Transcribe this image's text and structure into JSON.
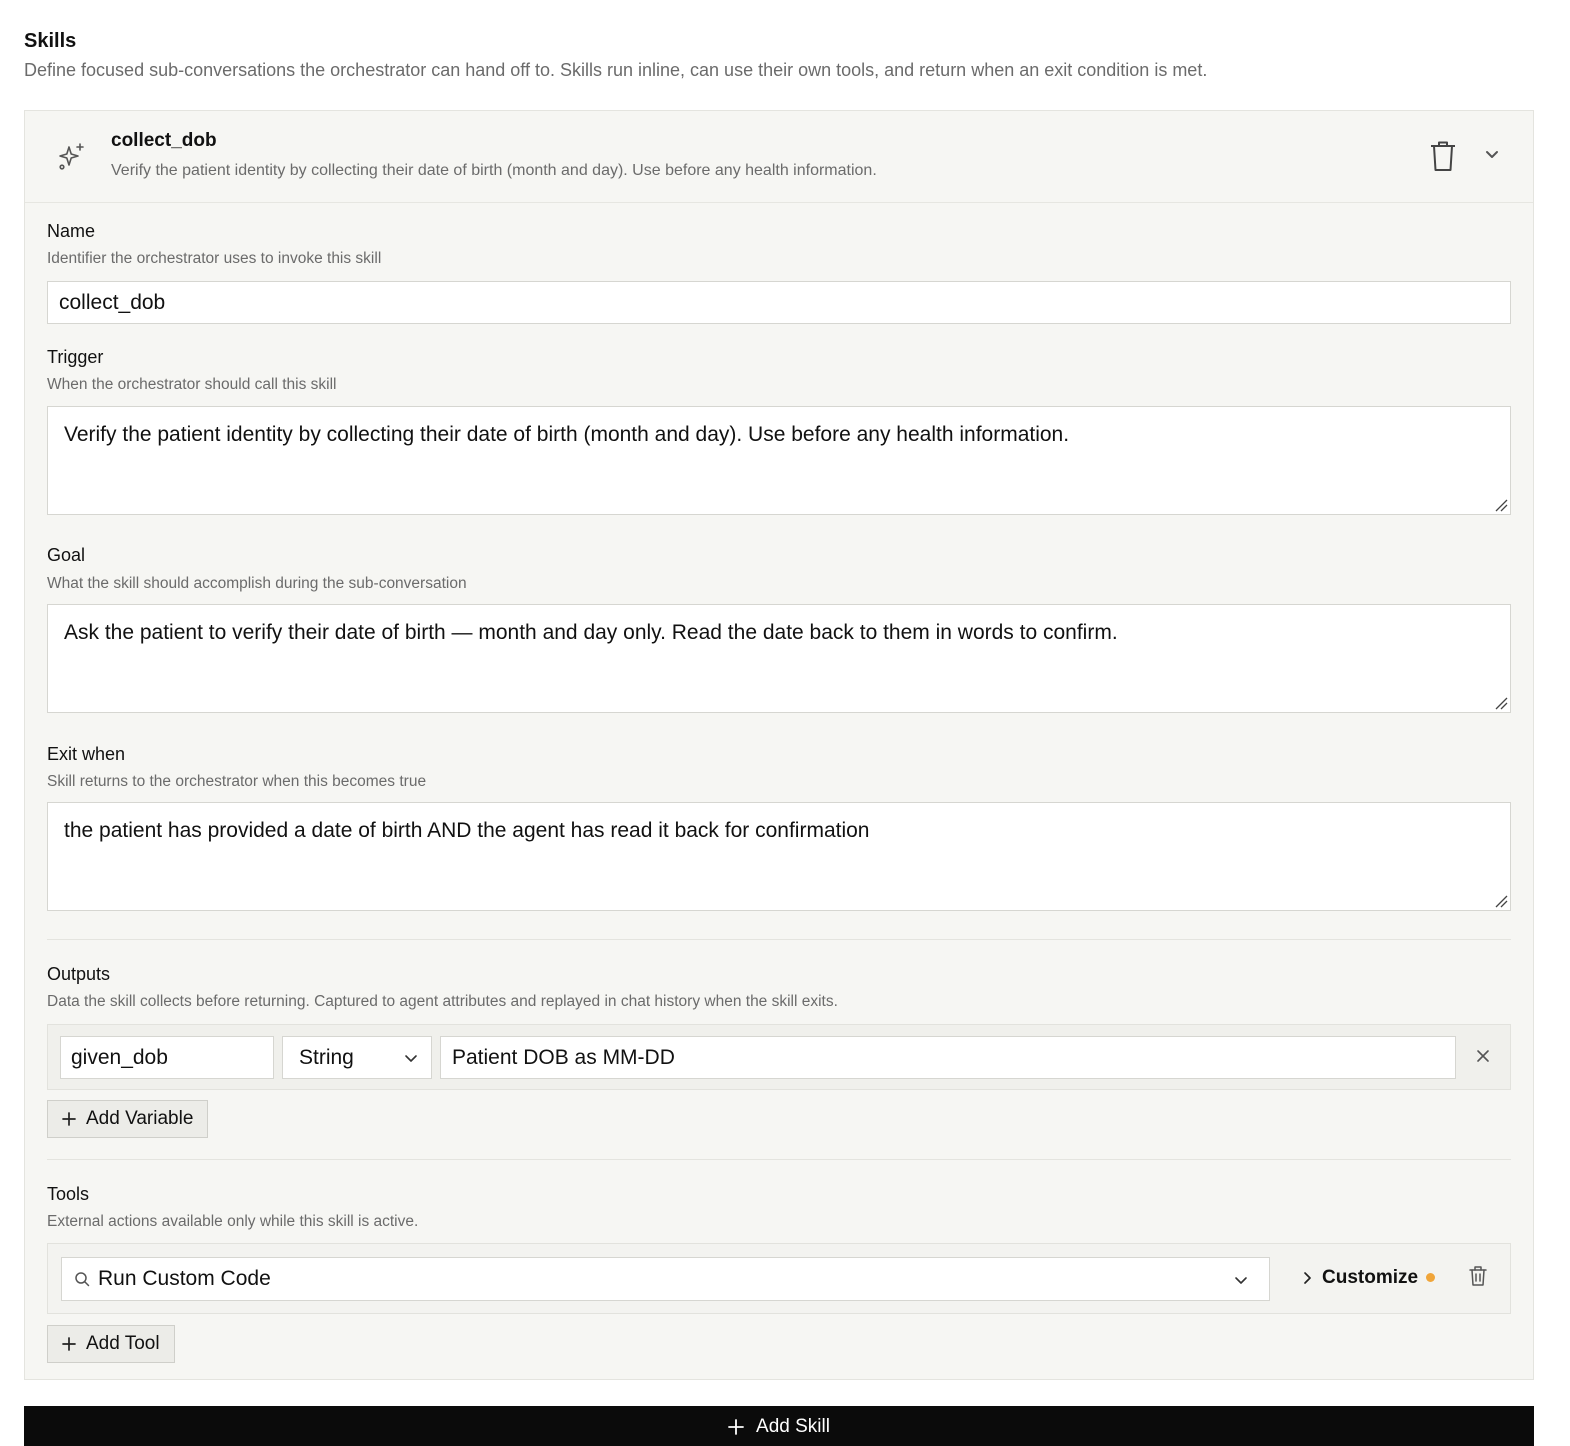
{
  "section": {
    "title": "Skills",
    "description": "Define focused sub-conversations the orchestrator can hand off to. Skills run inline, can use their own tools, and return when an exit condition is met."
  },
  "skill": {
    "name": "collect_dob",
    "summary": "Verify the patient identity by collecting their date of birth (month and day). Use before any health information.",
    "fields": {
      "name": {
        "label": "Name",
        "help": "Identifier the orchestrator uses to invoke this skill",
        "value": "collect_dob"
      },
      "trigger": {
        "label": "Trigger",
        "help": "When the orchestrator should call this skill",
        "value": "Verify the patient identity by collecting their date of birth (month and day). Use before any health information."
      },
      "goal": {
        "label": "Goal",
        "help": "What the skill should accomplish during the sub-conversation",
        "value": "Ask the patient to verify their date of birth — month and day only. Read the date back to them in words to confirm."
      },
      "exit_when": {
        "label": "Exit when",
        "help": "Skill returns to the orchestrator when this becomes true",
        "value": "the patient has provided a date of birth AND the agent has read it back for confirmation"
      }
    },
    "outputs": {
      "label": "Outputs",
      "help": "Data the skill collects before returning. Captured to agent attributes and replayed in chat history when the skill exits.",
      "variables": [
        {
          "name": "given_dob",
          "type": "String",
          "description": "Patient DOB as MM-DD"
        }
      ],
      "add_label": "Add Variable"
    },
    "tools": {
      "label": "Tools",
      "help": "External actions available only while this skill is active.",
      "items": [
        {
          "selected": "Run Custom Code",
          "customize_label": "Customize"
        }
      ],
      "add_label": "Add Tool"
    }
  },
  "add_skill_label": "Add Skill",
  "colors": {
    "card_bg": "#f6f6f3",
    "primary_button": "#0b0b0b",
    "status_dot": "#f0a53a",
    "muted_text": "#6b6b6b"
  },
  "icons": [
    "sparkle-icon",
    "trash-icon",
    "chevron-down-icon",
    "close-icon",
    "plus-icon",
    "search-icon",
    "chevron-right-icon",
    "resize-handle-icon"
  ]
}
